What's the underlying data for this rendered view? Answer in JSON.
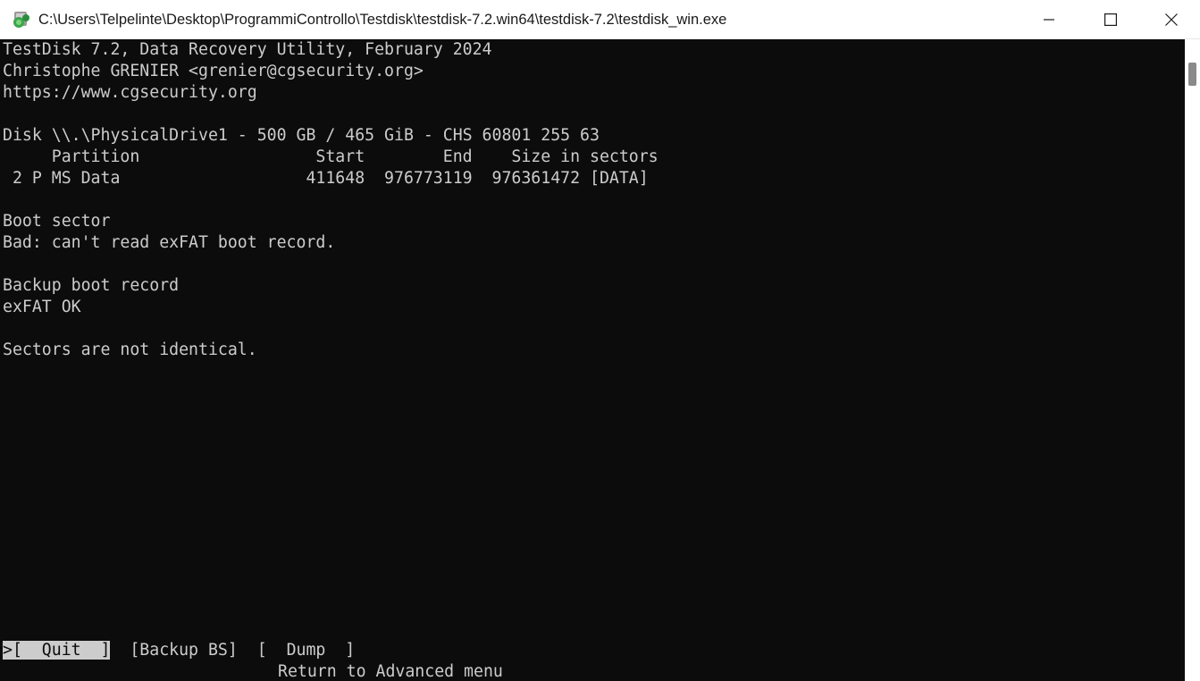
{
  "window": {
    "title": "C:\\Users\\Telpelinte\\Desktop\\ProgrammiControllo\\Testdisk\\testdisk-7.2.win64\\testdisk-7.2\\testdisk_win.exe"
  },
  "console": {
    "header_line1": "TestDisk 7.2, Data Recovery Utility, February 2024",
    "header_line2": "Christophe GRENIER <grenier@cgsecurity.org>",
    "header_line3": "https://www.cgsecurity.org",
    "disk_line": "Disk \\\\.\\PhysicalDrive1 - 500 GB / 465 GiB - CHS 60801 255 63",
    "table_header": "     Partition                  Start        End    Size in sectors",
    "partition_row": " 2 P MS Data                   411648  976773119  976361472 [DATA]",
    "boot_sector_label": "Boot sector",
    "boot_sector_status": "Bad: can't read exFAT boot record.",
    "backup_label": "Backup boot record",
    "backup_status": "exFAT OK",
    "comparison_status": "Sectors are not identical."
  },
  "menu": {
    "quit": ">[  Quit  ]",
    "backup_bs": "[Backup BS]",
    "dump": "[  Dump  ]",
    "hint": "Return to Advanced menu"
  },
  "colors": {
    "console_bg": "#0c0c0c",
    "console_fg": "#cccccc",
    "titlebar_bg": "#ffffff"
  }
}
